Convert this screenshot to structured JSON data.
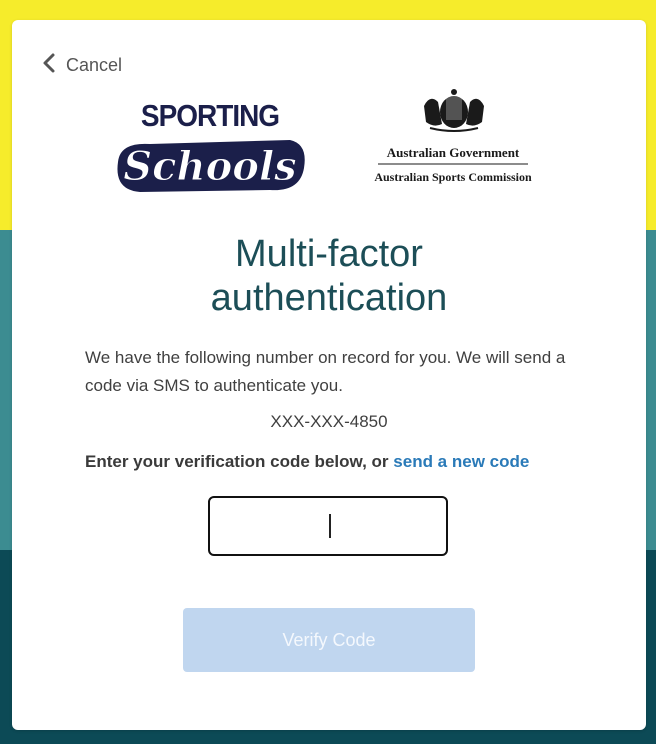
{
  "nav": {
    "cancel_label": "Cancel"
  },
  "logos": {
    "sporting_line1": "SPORTING",
    "sporting_line2": "Schools",
    "gov_line1": "Australian Government",
    "gov_line2": "Australian Sports Commission"
  },
  "page": {
    "title_line1": "Multi-factor",
    "title_line2": "authentication",
    "intro_text": "We have the following number on record for you. We will send a code via SMS to authenticate you.",
    "phone_masked": "XXX-XXX-4850",
    "prompt_text": "Enter your verification code below, or ",
    "prompt_link": "send a new code"
  },
  "form": {
    "code_value": "",
    "verify_label": "Verify Code"
  },
  "colors": {
    "yellow": "#f6ec2b",
    "teal": "#3c8c91",
    "dark_teal": "#0c4a56",
    "title": "#1c4e57",
    "link": "#2a7ab8",
    "button_disabled": "#c0d6ef"
  }
}
